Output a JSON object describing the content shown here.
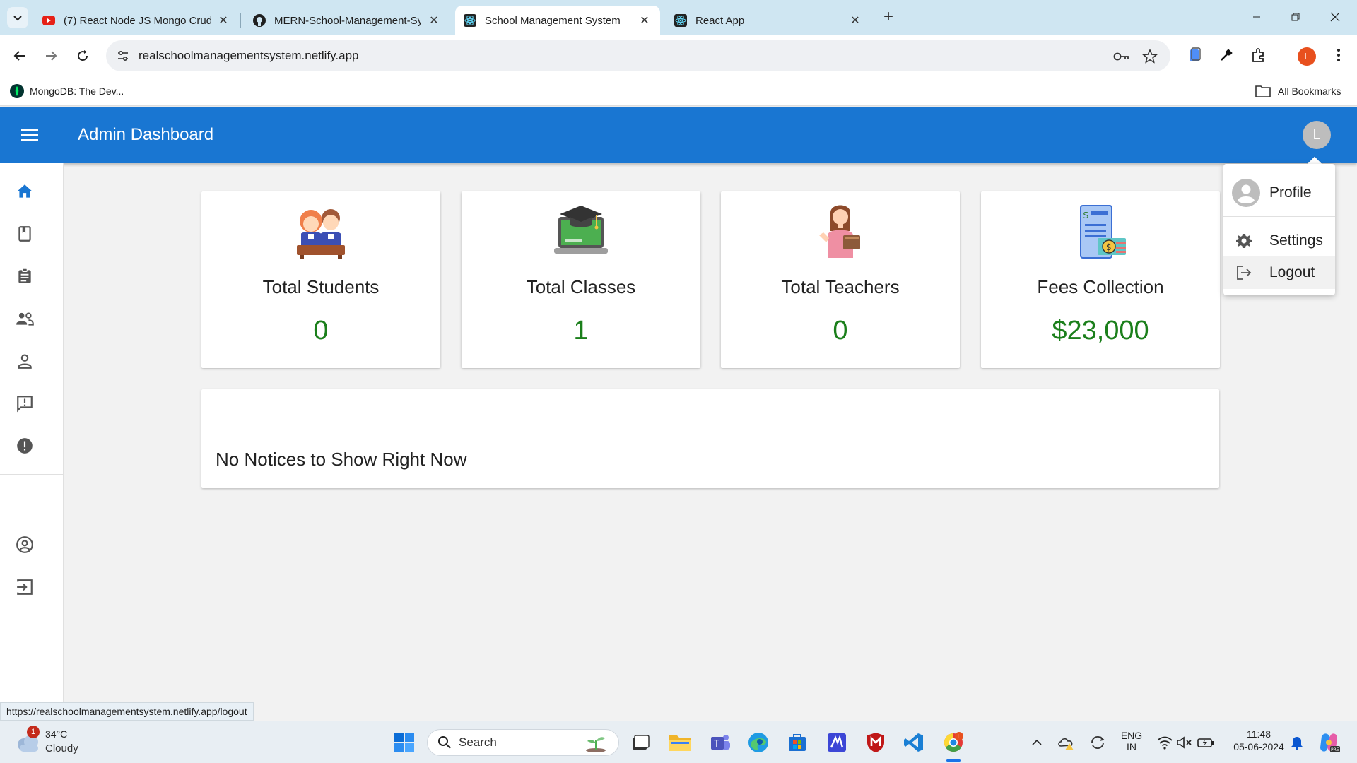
{
  "browser": {
    "tabs": [
      {
        "title": "(7) React Node JS Mongo Crud",
        "favicon": "youtube-icon",
        "active": false
      },
      {
        "title": "MERN-School-Management-Sy",
        "favicon": "github-icon",
        "active": false
      },
      {
        "title": "School Management System",
        "favicon": "react-icon",
        "active": true
      },
      {
        "title": "React App",
        "favicon": "react-icon",
        "active": false
      }
    ],
    "url": "realschoolmanagementsystem.netlify.app",
    "profile_initial": "L",
    "bookmarks": [
      {
        "label": "MongoDB: The Dev...",
        "icon": "mongodb-leaf-icon"
      }
    ],
    "all_bookmarks_label": "All Bookmarks"
  },
  "app": {
    "title": "Admin Dashboard",
    "user_initial": "L",
    "accent_color": "#1976d2",
    "value_color": "#1b7f1b",
    "sidebar": {
      "top_items": [
        "home-icon",
        "book-icon",
        "assignment-icon",
        "people-icon",
        "person-icon",
        "feedback-icon",
        "report-icon"
      ],
      "bottom_items": [
        "account-circle-icon",
        "exit-icon"
      ]
    },
    "stats": [
      {
        "label": "Total Students",
        "value": "0",
        "icon": "students-illustration"
      },
      {
        "label": "Total Classes",
        "value": "1",
        "icon": "classes-illustration"
      },
      {
        "label": "Total Teachers",
        "value": "0",
        "icon": "teacher-illustration"
      },
      {
        "label": "Fees Collection",
        "value": "$23,000",
        "icon": "fees-illustration"
      }
    ],
    "notice_text": "No Notices to Show Right Now",
    "profile_menu": {
      "items": [
        {
          "label": "Profile",
          "icon": "avatar-icon"
        },
        {
          "label": "Settings",
          "icon": "gear-icon"
        },
        {
          "label": "Logout",
          "icon": "logout-icon"
        }
      ]
    }
  },
  "status_link": "https://realschoolmanagementsystem.netlify.app/logout",
  "taskbar": {
    "weather": {
      "temp": "34°C",
      "condition": "Cloudy",
      "badge": "1"
    },
    "search_label": "Search",
    "language": {
      "line1": "ENG",
      "line2": "IN"
    },
    "time": "11:48",
    "date": "05-06-2024"
  }
}
